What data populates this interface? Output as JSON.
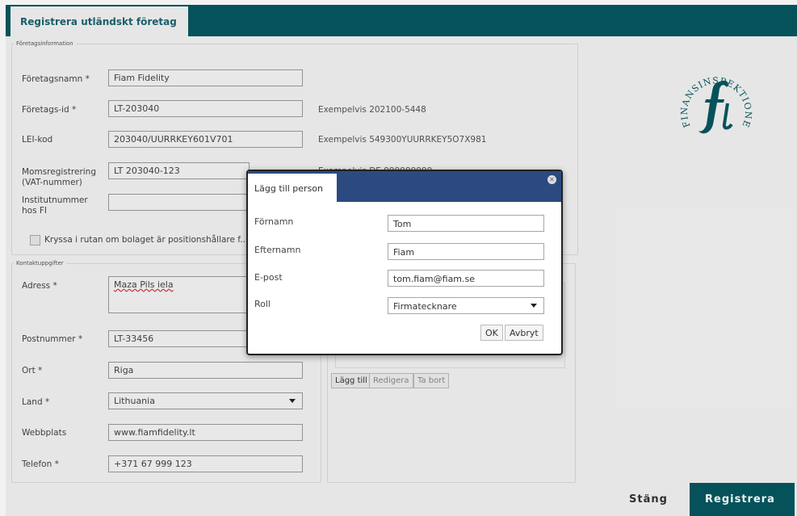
{
  "window": {
    "tab_title": "Registrera utländskt företag"
  },
  "company": {
    "legend": "Företagsinformation",
    "name_label": "Företagsnamn *",
    "name_value": "Fiam Fidelity",
    "id_label": "Företags-id *",
    "id_value": "LT-203040",
    "id_hint": "Exempelvis 202100-5448",
    "lei_label": "LEI-kod",
    "lei_value": "203040/UURRKEY601V701",
    "lei_hint": "Exempelvis 549300YUURRKEY5O7X981",
    "vat_label_1": "Momsregistrering",
    "vat_label_2": "(VAT-nummer)",
    "vat_value": "LT 203040-123",
    "vat_hint": "Exempelvis DE 999999999",
    "inst_label_1": "Institutnummer",
    "inst_label_2": "hos FI",
    "inst_value": "",
    "checkbox_label": "Kryssa i rutan om bolaget är positionshållare f..."
  },
  "contact": {
    "legend": "Kontaktuppgifter",
    "address_label": "Adress *",
    "address_value": "Maza Pils iela",
    "postal_label": "Postnummer *",
    "postal_value": "LT-33456",
    "city_label": "Ort *",
    "city_value": "Riga",
    "country_label": "Land *",
    "country_value": "Lithuania",
    "web_label": "Webbplats",
    "web_value": "www.fiamfidelity.lt",
    "phone_label": "Telefon *",
    "phone_value": "+371 67 999 123"
  },
  "persons": {
    "add": "Lägg till",
    "edit": "Redigera",
    "remove": "Ta bort"
  },
  "logo": {
    "text": "FINANSINSPEKTIONEN"
  },
  "modal": {
    "title": "Lägg till person",
    "first_label": "Förnamn",
    "first_value": "Tom",
    "last_label": "Efternamn",
    "last_value": "Fiam",
    "email_label": "E-post",
    "email_value": "tom.fiam@fiam.se",
    "role_label": "Roll",
    "role_value": "Firmatecknare",
    "ok": "OK",
    "cancel": "Avbryt"
  },
  "footer": {
    "close": "Stäng",
    "register": "Registrera"
  },
  "colors": {
    "header": "#06575f",
    "modal_header": "#2c4a80",
    "register_btn": "#06575f"
  }
}
